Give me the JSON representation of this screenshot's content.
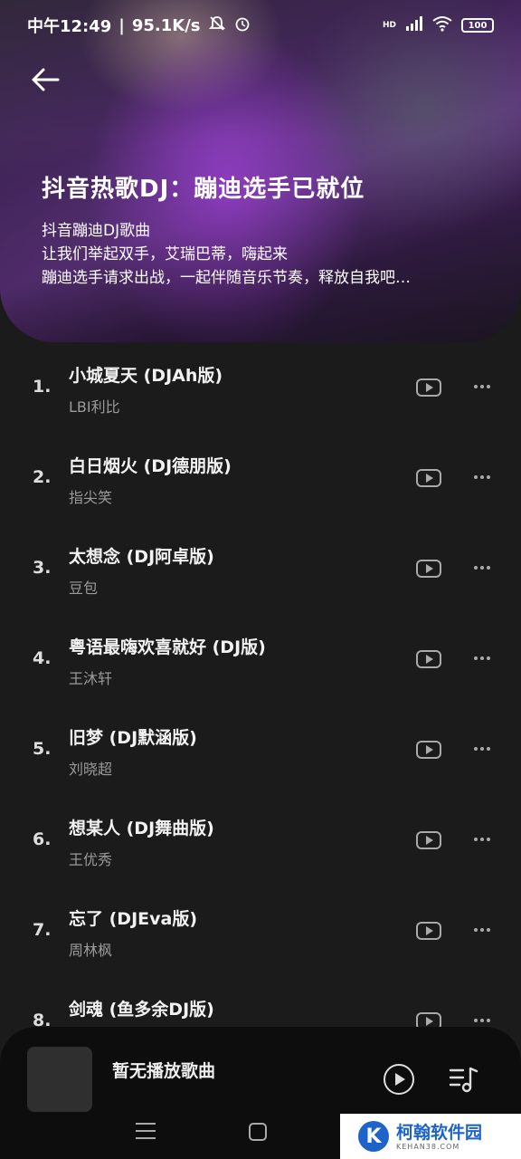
{
  "status_bar": {
    "time": "中午12:49",
    "speed": "95.1K/s",
    "network": "HD",
    "battery": "100"
  },
  "header": {
    "title": "抖音热歌DJ：蹦迪选手已就位",
    "description": [
      "抖音蹦迪DJ歌曲",
      "让我们举起双手，艾瑞巴蒂，嗨起来",
      "蹦迪选手请求出战，一起伴随音乐节奏，释放自我吧…"
    ]
  },
  "songs": [
    {
      "index": "1.",
      "title": "小城夏天 (DJAh版)",
      "artist": "LBI利比"
    },
    {
      "index": "2.",
      "title": "白日烟火 (DJ德朋版)",
      "artist": "指尖笑"
    },
    {
      "index": "3.",
      "title": "太想念 (DJ阿卓版)",
      "artist": "豆包"
    },
    {
      "index": "4.",
      "title": "粤语最嗨欢喜就好 (DJ版)",
      "artist": "王沐轩"
    },
    {
      "index": "5.",
      "title": "旧梦 (DJ默涵版)",
      "artist": "刘晓超"
    },
    {
      "index": "6.",
      "title": "想某人 (DJ舞曲版)",
      "artist": "王优秀"
    },
    {
      "index": "7.",
      "title": "忘了 (DJEva版)",
      "artist": "周林枫"
    },
    {
      "index": "8.",
      "title": "剑魂 (鱼多余DJ版)",
      "artist": ""
    }
  ],
  "player": {
    "now_playing": "暂无播放歌曲"
  },
  "watermark": {
    "logo": "K",
    "name": "柯翰软件园",
    "sub": "KEHAN38.COM"
  }
}
